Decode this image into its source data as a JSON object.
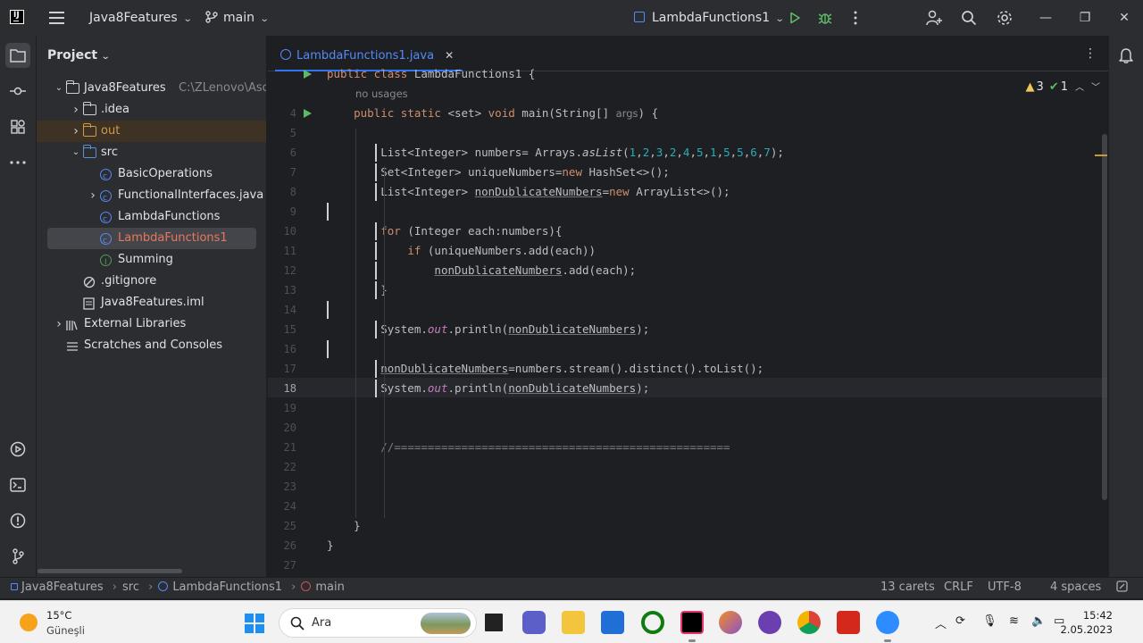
{
  "titlebar": {
    "project_name": "Java8Features",
    "branch": "main",
    "run_config": "LambdaFunctions1"
  },
  "project_panel": {
    "header": "Project",
    "tree": [
      {
        "label": "Java8Features",
        "extra": "C:\\ZLenovo\\Aso",
        "kind": "module",
        "depth": 0,
        "expanded": true
      },
      {
        "label": ".idea",
        "kind": "folder",
        "depth": 1,
        "expanded": false
      },
      {
        "label": "out",
        "kind": "folder-excluded",
        "depth": 1,
        "expanded": false
      },
      {
        "label": "src",
        "kind": "folder-source",
        "depth": 1,
        "expanded": true
      },
      {
        "label": "BasicOperations",
        "kind": "class",
        "depth": 2
      },
      {
        "label": "FunctionalInterfaces.java",
        "kind": "class",
        "depth": 2,
        "expanded": false
      },
      {
        "label": "LambdaFunctions",
        "kind": "class",
        "depth": 2
      },
      {
        "label": "LambdaFunctions1",
        "kind": "class",
        "depth": 2,
        "selected": true
      },
      {
        "label": "Summing",
        "kind": "interface",
        "depth": 2
      },
      {
        "label": ".gitignore",
        "kind": "file",
        "depth": 1
      },
      {
        "label": "Java8Features.iml",
        "kind": "file",
        "depth": 1
      },
      {
        "label": "External Libraries",
        "kind": "library",
        "depth": 0,
        "expanded": false
      },
      {
        "label": "Scratches and Consoles",
        "kind": "scratch",
        "depth": 0
      }
    ]
  },
  "editor": {
    "tab_label": "LambdaFunctions1.java",
    "inspections": {
      "warnings": "3",
      "ok": "1"
    },
    "usage_hint": "no usages",
    "lines": [
      {
        "n": "",
        "html": "<span class=\"kw\">public class</span> LambdaFunctions1 {"
      },
      {
        "n": "4",
        "html": "    <span class=\"kw\">public static</span> &lt;set&gt; <span class=\"kw\">void</span> main(String[] <span class=\"hint\">args</span>) {"
      },
      {
        "n": "5",
        "html": ""
      },
      {
        "n": "6",
        "html": "        List&lt;Integer&gt; numbers= Arrays.<span class=\"it\">asList</span>(<span class=\"num\">1</span>,<span class=\"num\">2</span>,<span class=\"num\">3</span>,<span class=\"num\">2</span>,<span class=\"num\">4</span>,<span class=\"num\">5</span>,<span class=\"num\">1</span>,<span class=\"num\">5</span>,<span class=\"num\">5</span>,<span class=\"num\">6</span>,<span class=\"num\">7</span>);"
      },
      {
        "n": "7",
        "html": "        Set&lt;Integer&gt; uniqueNumbers=<span class=\"kw\">new</span> HashSet&lt;&gt;();"
      },
      {
        "n": "8",
        "html": "        List&lt;Integer&gt; <span class=\"u\">nonDublicateNumbers</span>=<span class=\"kw\">new</span> ArrayList&lt;&gt;();"
      },
      {
        "n": "9",
        "html": ""
      },
      {
        "n": "10",
        "html": "        <span class=\"kw\">for</span> (Integer each:numbers){"
      },
      {
        "n": "11",
        "html": "            <span class=\"kw\">if</span> (uniqueNumbers.add(each))"
      },
      {
        "n": "12",
        "html": "                <span class=\"u\">nonDublicateNumbers</span>.add(each);"
      },
      {
        "n": "13",
        "html": "        }"
      },
      {
        "n": "14",
        "html": ""
      },
      {
        "n": "15",
        "html": "        System.<span class=\"fld\">out</span>.println(<span class=\"u\">nonDublicateNumbers</span>);"
      },
      {
        "n": "16",
        "html": ""
      },
      {
        "n": "17",
        "html": "        <span class=\"u\">nonDublicateNumbers</span>=numbers.stream().distinct().toList();"
      },
      {
        "n": "18",
        "html": "        System.<span class=\"fld\">out</span>.println(<span class=\"u\">nonDublicateNumbers</span>);"
      },
      {
        "n": "19",
        "html": ""
      },
      {
        "n": "20",
        "html": ""
      },
      {
        "n": "21",
        "html": "        <span class=\"cm\">//==================================================</span>"
      },
      {
        "n": "22",
        "html": ""
      },
      {
        "n": "23",
        "html": ""
      },
      {
        "n": "24",
        "html": ""
      },
      {
        "n": "25",
        "html": "    }"
      },
      {
        "n": "26",
        "html": "}"
      },
      {
        "n": "27",
        "html": ""
      }
    ]
  },
  "statusbar": {
    "breadcrumb": [
      "Java8Features",
      "src",
      "LambdaFunctions1",
      "main"
    ],
    "carets": "13 carets",
    "line_sep": "CRLF",
    "encoding": "UTF-8",
    "indent": "4 spaces"
  },
  "taskbar": {
    "temperature": "15°C",
    "weather": "Güneşli",
    "search_label": "Ara",
    "time": "15:42",
    "date": "2.05.2023"
  },
  "colors": {
    "keyword": "#cf8e6d",
    "number": "#2aacb8",
    "field": "#c77dbb",
    "accent": "#3574f0",
    "run": "#5fb865"
  }
}
